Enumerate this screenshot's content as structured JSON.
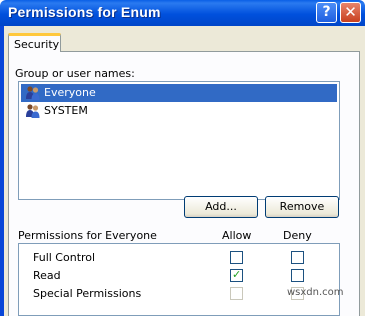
{
  "window": {
    "title": "Permissions for Enum",
    "help_glyph": "?",
    "close_glyph": "✕"
  },
  "tabs": [
    {
      "label": "Security"
    }
  ],
  "group_section": {
    "label": "Group or user names:",
    "items": [
      {
        "label": "Everyone",
        "selected": true,
        "icon": "users-group-icon"
      },
      {
        "label": "SYSTEM",
        "selected": false,
        "icon": "users-group-icon"
      }
    ]
  },
  "buttons": {
    "add": "Add...",
    "remove": "Remove"
  },
  "permissions": {
    "header": "Permissions for Everyone",
    "allow_header": "Allow",
    "deny_header": "Deny",
    "rows": [
      {
        "label": "Full Control",
        "allow": false,
        "deny": false,
        "enabled": true
      },
      {
        "label": "Read",
        "allow": true,
        "deny": false,
        "enabled": true
      },
      {
        "label": "Special Permissions",
        "allow": false,
        "deny": false,
        "enabled": false
      }
    ]
  },
  "watermark": "wsxdn.com",
  "colors": {
    "titlebar": "#0050dd",
    "selection": "#316ac5",
    "check": "#21a121",
    "tab_highlight": "#ffc83c"
  }
}
